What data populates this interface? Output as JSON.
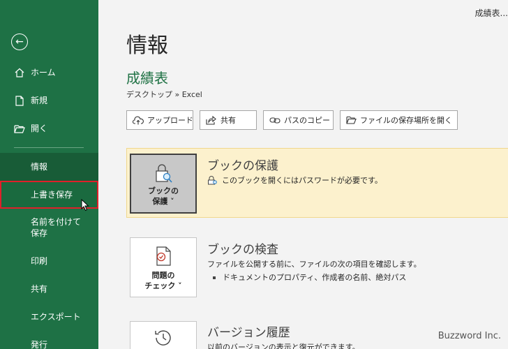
{
  "window_title": "成績表...",
  "sidebar": {
    "items": [
      {
        "label": "ホーム"
      },
      {
        "label": "新規"
      },
      {
        "label": "開く"
      },
      {
        "label": "情報"
      },
      {
        "label": "上書き保存"
      },
      {
        "label": "名前を付けて保存"
      },
      {
        "label": "印刷"
      },
      {
        "label": "共有"
      },
      {
        "label": "エクスポート"
      },
      {
        "label": "発行"
      }
    ],
    "colors": {
      "background": "#1e7145",
      "active": "#185c37",
      "highlight_border": "#e0202a"
    }
  },
  "main": {
    "title": "情報",
    "doc_title": "成績表",
    "path": "デスクトップ » Excel",
    "toolbar": [
      {
        "label": "アップロード",
        "icon": "upload-cloud-icon"
      },
      {
        "label": "共有",
        "icon": "share-icon"
      },
      {
        "label": "パスのコピー",
        "icon": "link-icon"
      },
      {
        "label": "ファイルの保存場所を開く",
        "icon": "folder-icon"
      }
    ],
    "protect": {
      "button_line1": "ブックの",
      "button_line2": "保護 ˅",
      "heading": "ブックの保護",
      "desc": "このブックを開くにはパスワードが必要です。"
    },
    "inspect": {
      "button_line1": "問題の",
      "button_line2": "チェック ˅",
      "heading": "ブックの検査",
      "desc": "ファイルを公開する前に、ファイルの次の項目を確認します。",
      "bullet": "ドキュメントのプロパティ、作成者の名前、絶対パス"
    },
    "history": {
      "heading": "バージョン履歴",
      "desc": "以前のバージョンの表示と復元ができます。"
    }
  },
  "watermark": "Buzzword Inc."
}
